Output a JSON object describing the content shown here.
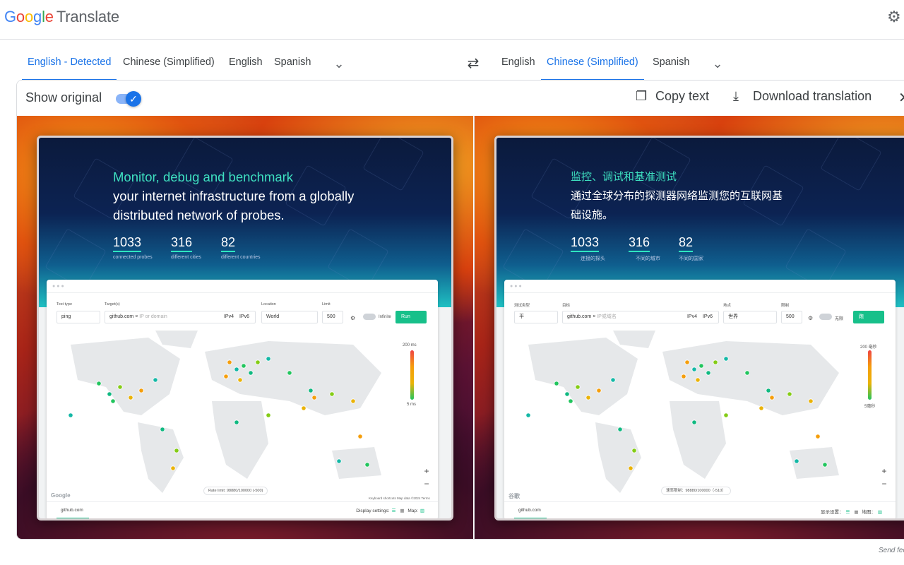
{
  "header": {
    "logo_google": "Google",
    "logo_product": "Translate",
    "settings_icon": "gear-icon"
  },
  "source_langs": [
    "English - Detected",
    "Chinese (Simplified)",
    "English",
    "Spanish"
  ],
  "target_langs": [
    "English",
    "Chinese (Simplified)",
    "Spanish"
  ],
  "toolbar": {
    "show_original": "Show original",
    "show_original_on": true,
    "copy": "Copy text",
    "download": "Download translation"
  },
  "original": {
    "headline_hl": "Monitor, debug and benchmark",
    "headline_rest": "your internet infrastructure from a globally distributed network of probes.",
    "stats": [
      {
        "num": "1033",
        "label": "connected probes"
      },
      {
        "num": "316",
        "label": "different cities"
      },
      {
        "num": "82",
        "label": "different countries"
      }
    ],
    "labels": {
      "test_type": "Test type",
      "targets": "Target(s)",
      "location": "Location",
      "limit": "Limit"
    },
    "values": {
      "test_type": "ping",
      "target": "github.com",
      "ip_placeholder": "IP or domain",
      "ipv4": "IPv4",
      "ipv6": "IPv6",
      "location": "World",
      "limit": "500",
      "infinite": "Infinite",
      "run": "Run"
    },
    "legend_top": "200 ms",
    "legend_bottom": "5 ms",
    "rate": "Rate limit: 98880/100000 (-500)",
    "map_footer": "Keyboard shortcuts   Map data ©2024   Terms",
    "watermark": "Google",
    "tab": "github.com",
    "display_settings": "Display settings:",
    "map_label": "Map:"
  },
  "translated": {
    "headline_hl": "监控、调试和基准测试",
    "headline_rest": "通过全球分布的探测器网络监测您的互联网基础设施。",
    "stats": [
      {
        "num": "1033",
        "label": "连接的探头"
      },
      {
        "num": "316",
        "label": "不同的城市"
      },
      {
        "num": "82",
        "label": "不同的国家"
      }
    ],
    "labels": {
      "test_type": "测试类型",
      "targets": "目标",
      "location": "地点",
      "limit": "限制"
    },
    "values": {
      "test_type": "平",
      "target": "github.com",
      "ip_placeholder": "IP或域名",
      "ipv4": "IPv4",
      "ipv6": "IPv6",
      "location": "世界",
      "limit": "500",
      "infinite": "无限",
      "run": "跑"
    },
    "legend_top": "200 毫秒",
    "legend_bottom": "5毫秒",
    "rate": "速率限制：98880/100000（-510）",
    "map_footer": "",
    "watermark": "谷歌",
    "tab": "github.com",
    "display_settings": "显示设置：",
    "map_label": "地图："
  },
  "feedback": "Send feedback",
  "colors": {
    "accent": "#1a73e8",
    "probe_green": "#22c55e",
    "run_green": "#17c08a"
  }
}
